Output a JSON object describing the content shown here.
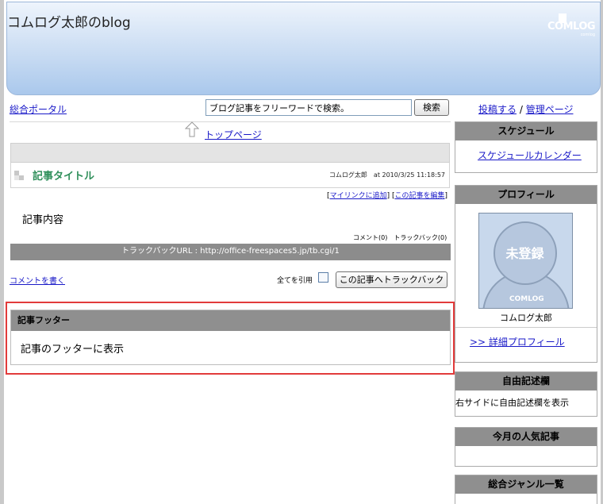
{
  "header": {
    "blog_title": "コムログ太郎のblog",
    "logo_text": "COMLOG",
    "logo_sub": "comlog"
  },
  "nav": {
    "portal_link": "総合ポータル",
    "search_placeholder": "ブログ記事をフリーワードで検索。",
    "search_button": "検索",
    "post_link": "投稿する",
    "link_separator": "/",
    "admin_link": "管理ページ"
  },
  "main": {
    "top_page_link": "トップページ",
    "article": {
      "title": "記事タイトル",
      "meta": "コムログ太郎　at 2010/3/25 11:18:57",
      "edit_links_prefix": "[",
      "mylink_label": "マイリンクに追加",
      "edit_links_mid": "] [",
      "edit_label": "この記事を編集",
      "edit_links_suffix": "]",
      "body": "記事内容",
      "counts": "コメント(0)　トラックバック(0)",
      "trackback_url": "トラックバックURL : http://office-freespaces5.jp/tb.cgi/1"
    },
    "comment_link": "コメントを書く",
    "quote_all_label": "全てを引用",
    "trackback_button": "この記事へトラックバック",
    "footer": {
      "heading": "記事フッター",
      "text": "記事のフッターに表示"
    }
  },
  "sidebar": {
    "schedule": {
      "heading": "スケジュール",
      "link": "スケジュールカレンダー"
    },
    "profile": {
      "heading": "プロフィール",
      "avatar_text": "未登録",
      "avatar_logo": "COMLOG",
      "name": "コムログ太郎",
      "detail_link": ">> 詳細プロフィール"
    },
    "free": {
      "heading": "自由記述欄",
      "text": "右サイドに自由記述欄を表示"
    },
    "popular": {
      "heading": "今月の人気記事"
    },
    "genre": {
      "heading": "総合ジャンル一覧"
    }
  },
  "colors": {
    "link": "#1a1ac8",
    "title_green": "#2f8f5a",
    "highlight_red": "#e23b3b",
    "head_gray": "#8f8f8f"
  }
}
